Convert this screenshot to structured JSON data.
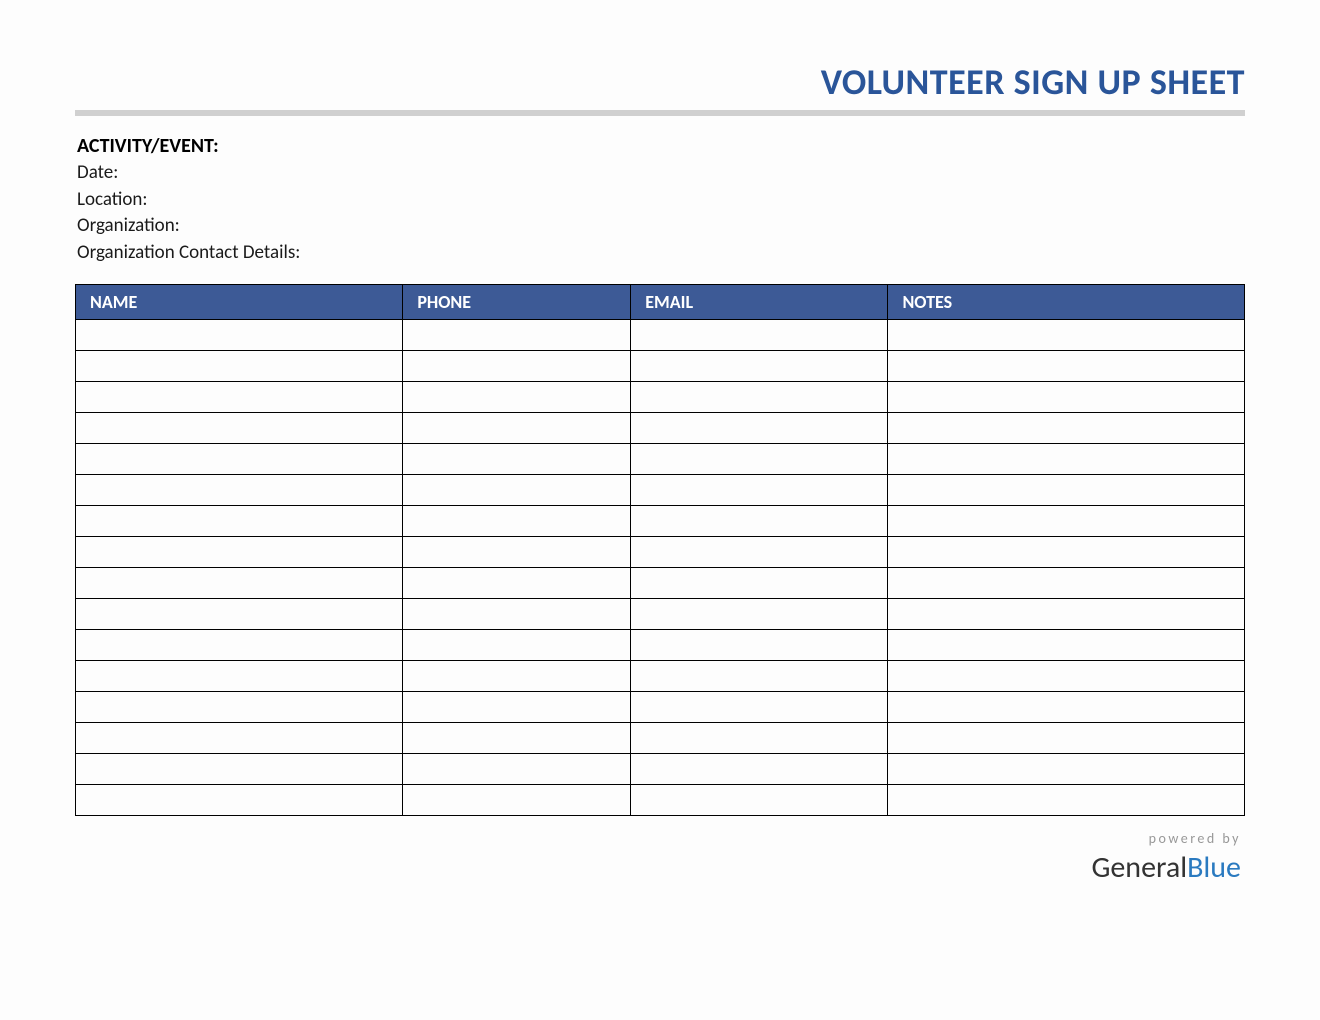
{
  "header": {
    "title": "VOLUNTEER SIGN UP SHEET"
  },
  "info": {
    "activity_label": "ACTIVITY/EVENT:",
    "date_label": "Date:",
    "location_label": "Location:",
    "organization_label": "Organization:",
    "contact_label": "Organization Contact Details:"
  },
  "table": {
    "headers": {
      "name": "NAME",
      "phone": "PHONE",
      "email": "EMAIL",
      "notes": "NOTES"
    },
    "row_count": 16
  },
  "footer": {
    "powered_by": "powered by",
    "brand_part1": "General",
    "brand_part2": "Blue"
  }
}
